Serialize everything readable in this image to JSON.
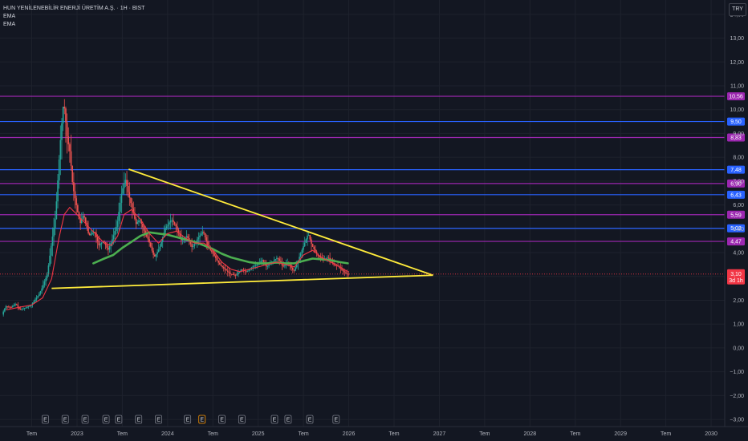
{
  "legend": {
    "title": "HUN YENİLENEBİLİR ENERJİ ÜRETİM A.Ş. · 1H · BIST",
    "ema1": "EMA",
    "ema2": "EMA"
  },
  "currency": "TRY",
  "chart_data": {
    "type": "candlestick",
    "title": "HUN YENİLENEBİLİR ENERJİ ÜRETİM A.Ş. · 1H · BIST",
    "ylim": [
      -3.3,
      14.6
    ],
    "xlim": [
      2022.15,
      2030.15
    ],
    "y_ticks": [
      14,
      13,
      12,
      11,
      10,
      9,
      8,
      7,
      6,
      5,
      4,
      3,
      2,
      1,
      0,
      -1,
      -2,
      -3
    ],
    "y_tick_labels": [
      "14,00",
      "13,00",
      "12,00",
      "11,00",
      "10,00",
      "9,00",
      "8,00",
      "7,00",
      "6,00",
      "5,00",
      "4,00",
      "3,00",
      "2,00",
      "1,00",
      "0,00",
      "−1,00",
      "−2,00",
      "−3,00"
    ],
    "x_ticks": [
      2022.5,
      2023,
      2023.5,
      2024,
      2024.5,
      2025,
      2025.5,
      2026,
      2026.5,
      2027,
      2027.5,
      2028,
      2028.5,
      2029,
      2029.5,
      2030
    ],
    "x_tick_labels": [
      "Tem",
      "2023",
      "Tem",
      "2024",
      "Tem",
      "2025",
      "Tem",
      "2026",
      "Tem",
      "2027",
      "Tem",
      "2028",
      "Tem",
      "2029",
      "Tem",
      "2030"
    ],
    "price_path": [
      [
        2022.18,
        1.4
      ],
      [
        2022.22,
        1.75
      ],
      [
        2022.28,
        1.7
      ],
      [
        2022.33,
        1.85
      ],
      [
        2022.38,
        1.6
      ],
      [
        2022.45,
        1.7
      ],
      [
        2022.5,
        1.8
      ],
      [
        2022.58,
        2.2
      ],
      [
        2022.62,
        2.5
      ],
      [
        2022.68,
        3.1
      ],
      [
        2022.73,
        4.5
      ],
      [
        2022.77,
        5.5
      ],
      [
        2022.82,
        8.5
      ],
      [
        2022.86,
        10.4
      ],
      [
        2022.9,
        8.8
      ],
      [
        2022.93,
        8.2
      ],
      [
        2022.96,
        6.8
      ],
      [
        2023.0,
        6.0
      ],
      [
        2023.04,
        5.2
      ],
      [
        2023.08,
        5.6
      ],
      [
        2023.14,
        4.7
      ],
      [
        2023.2,
        4.9
      ],
      [
        2023.25,
        4.3
      ],
      [
        2023.3,
        4.5
      ],
      [
        2023.35,
        4.1
      ],
      [
        2023.4,
        4.6
      ],
      [
        2023.45,
        5.2
      ],
      [
        2023.5,
        6.5
      ],
      [
        2023.54,
        7.1
      ],
      [
        2023.58,
        6.4
      ],
      [
        2023.62,
        5.8
      ],
      [
        2023.66,
        5.2
      ],
      [
        2023.7,
        5.4
      ],
      [
        2023.76,
        4.8
      ],
      [
        2023.8,
        4.5
      ],
      [
        2023.86,
        3.8
      ],
      [
        2023.92,
        4.2
      ],
      [
        2023.98,
        5.0
      ],
      [
        2024.05,
        5.4
      ],
      [
        2024.1,
        5.1
      ],
      [
        2024.16,
        4.5
      ],
      [
        2024.22,
        4.7
      ],
      [
        2024.28,
        4.2
      ],
      [
        2024.34,
        4.6
      ],
      [
        2024.4,
        4.9
      ],
      [
        2024.46,
        4.2
      ],
      [
        2024.52,
        3.9
      ],
      [
        2024.58,
        3.5
      ],
      [
        2024.64,
        3.3
      ],
      [
        2024.7,
        3.1
      ],
      [
        2024.76,
        3.05
      ],
      [
        2024.82,
        3.3
      ],
      [
        2024.88,
        3.2
      ],
      [
        2024.94,
        3.4
      ],
      [
        2025.0,
        3.5
      ],
      [
        2025.05,
        3.7
      ],
      [
        2025.1,
        3.4
      ],
      [
        2025.16,
        3.6
      ],
      [
        2025.22,
        3.8
      ],
      [
        2025.28,
        3.4
      ],
      [
        2025.34,
        3.6
      ],
      [
        2025.4,
        3.2
      ],
      [
        2025.46,
        3.8
      ],
      [
        2025.52,
        4.4
      ],
      [
        2025.56,
        4.8
      ],
      [
        2025.6,
        4.3
      ],
      [
        2025.66,
        3.9
      ],
      [
        2025.72,
        3.7
      ],
      [
        2025.78,
        3.8
      ],
      [
        2025.84,
        3.5
      ],
      [
        2025.9,
        3.4
      ],
      [
        2025.95,
        3.2
      ],
      [
        2025.99,
        3.1
      ]
    ],
    "ema_short": [
      [
        2022.22,
        1.6
      ],
      [
        2022.35,
        1.7
      ],
      [
        2022.5,
        1.8
      ],
      [
        2022.62,
        2.1
      ],
      [
        2022.72,
        2.9
      ],
      [
        2022.8,
        4.6
      ],
      [
        2022.86,
        5.6
      ],
      [
        2022.92,
        5.9
      ],
      [
        2023.0,
        5.6
      ],
      [
        2023.1,
        5.2
      ],
      [
        2023.2,
        4.8
      ],
      [
        2023.3,
        4.4
      ],
      [
        2023.38,
        4.3
      ],
      [
        2023.45,
        4.7
      ],
      [
        2023.52,
        5.6
      ],
      [
        2023.6,
        5.8
      ],
      [
        2023.7,
        5.4
      ],
      [
        2023.8,
        4.8
      ],
      [
        2023.9,
        4.4
      ],
      [
        2024.0,
        4.8
      ],
      [
        2024.1,
        4.9
      ],
      [
        2024.2,
        4.6
      ],
      [
        2024.3,
        4.4
      ],
      [
        2024.4,
        4.4
      ],
      [
        2024.5,
        4.1
      ],
      [
        2024.6,
        3.6
      ],
      [
        2024.7,
        3.3
      ],
      [
        2024.8,
        3.2
      ],
      [
        2024.9,
        3.3
      ],
      [
        2025.0,
        3.4
      ],
      [
        2025.1,
        3.5
      ],
      [
        2025.2,
        3.6
      ],
      [
        2025.3,
        3.5
      ],
      [
        2025.4,
        3.4
      ],
      [
        2025.5,
        3.9
      ],
      [
        2025.6,
        4.1
      ],
      [
        2025.7,
        3.8
      ],
      [
        2025.8,
        3.6
      ],
      [
        2025.9,
        3.4
      ],
      [
        2025.99,
        3.2
      ]
    ],
    "ema_long": [
      [
        2023.18,
        3.55
      ],
      [
        2023.3,
        3.75
      ],
      [
        2023.4,
        3.9
      ],
      [
        2023.5,
        4.2
      ],
      [
        2023.6,
        4.45
      ],
      [
        2023.7,
        4.7
      ],
      [
        2023.8,
        4.85
      ],
      [
        2023.9,
        4.8
      ],
      [
        2024.0,
        4.75
      ],
      [
        2024.1,
        4.65
      ],
      [
        2024.2,
        4.55
      ],
      [
        2024.3,
        4.45
      ],
      [
        2024.4,
        4.3
      ],
      [
        2024.5,
        4.15
      ],
      [
        2024.6,
        3.95
      ],
      [
        2024.7,
        3.8
      ],
      [
        2024.8,
        3.7
      ],
      [
        2024.9,
        3.6
      ],
      [
        2025.0,
        3.55
      ],
      [
        2025.1,
        3.55
      ],
      [
        2025.2,
        3.58
      ],
      [
        2025.3,
        3.55
      ],
      [
        2025.4,
        3.55
      ],
      [
        2025.5,
        3.65
      ],
      [
        2025.6,
        3.75
      ],
      [
        2025.7,
        3.72
      ],
      [
        2025.8,
        3.68
      ],
      [
        2025.9,
        3.6
      ],
      [
        2025.99,
        3.55
      ]
    ],
    "trendlines": [
      {
        "from": [
          2022.72,
          2.5
        ],
        "to": [
          2026.93,
          3.05
        ],
        "color": "#ffeb3b"
      },
      {
        "from": [
          2023.57,
          7.5
        ],
        "to": [
          2026.93,
          3.05
        ],
        "color": "#ffeb3b"
      }
    ],
    "horizontal_levels": [
      {
        "value": 10.56,
        "label": "10,56",
        "color": "#9c27b0"
      },
      {
        "value": 9.5,
        "label": "9,50",
        "color": "#2962ff"
      },
      {
        "value": 8.83,
        "label": "8,83",
        "color": "#9c27b0"
      },
      {
        "value": 7.48,
        "label": "7,48",
        "color": "#2962ff"
      },
      {
        "value": 6.9,
        "label": "6,90",
        "color": "#9c27b0"
      },
      {
        "value": 6.43,
        "label": "6,43",
        "color": "#2962ff"
      },
      {
        "value": 5.59,
        "label": "5,59",
        "color": "#9c27b0"
      },
      {
        "value": 5.02,
        "label": "5,02",
        "color": "#2962ff"
      },
      {
        "value": 4.47,
        "label": "4,47",
        "color": "#9c27b0"
      }
    ],
    "last_price": {
      "value": 3.1,
      "label": "3,10",
      "countdown": "3d 1h",
      "color": "#f23645"
    },
    "events": [
      {
        "x": 2022.65,
        "label": "E"
      },
      {
        "x": 2022.87,
        "label": "E"
      },
      {
        "x": 2023.09,
        "label": "E"
      },
      {
        "x": 2023.32,
        "label": "E"
      },
      {
        "x": 2023.46,
        "label": "E"
      },
      {
        "x": 2023.68,
        "label": "E"
      },
      {
        "x": 2023.9,
        "label": "E"
      },
      {
        "x": 2024.22,
        "label": "E"
      },
      {
        "x": 2024.38,
        "label": "E",
        "highlight": true
      },
      {
        "x": 2024.6,
        "label": "E"
      },
      {
        "x": 2024.82,
        "label": "E"
      },
      {
        "x": 2025.18,
        "label": "E"
      },
      {
        "x": 2025.33,
        "label": "E"
      },
      {
        "x": 2025.57,
        "label": "E"
      },
      {
        "x": 2025.86,
        "label": "E"
      }
    ],
    "colors": {
      "up": "#26a69a",
      "down": "#ef5350",
      "ema_short": "#f23645",
      "ema_long": "#4caf50"
    }
  }
}
